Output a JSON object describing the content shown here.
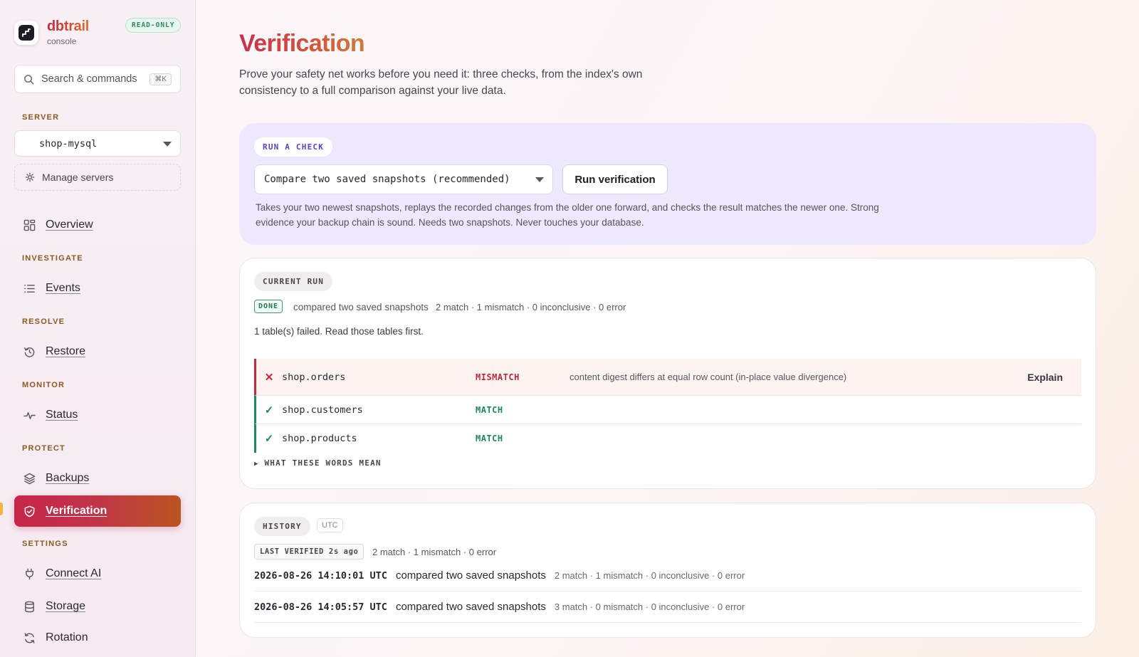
{
  "brand": {
    "name": "dbtrail",
    "subtitle": "console",
    "mode_badge": "READ-ONLY"
  },
  "search": {
    "placeholder": "Search & commands",
    "shortcut": "⌘K"
  },
  "server": {
    "section_label": "SERVER",
    "selected": "shop-mysql",
    "manage_label": "Manage servers"
  },
  "nav": {
    "overview": "Overview",
    "investigate_label": "INVESTIGATE",
    "events": "Events",
    "resolve_label": "RESOLVE",
    "restore": "Restore",
    "monitor_label": "MONITOR",
    "status": "Status",
    "protect_label": "PROTECT",
    "backups": "Backups",
    "verification": "Verification",
    "settings_label": "SETTINGS",
    "connect_ai": "Connect AI",
    "storage": "Storage",
    "rotation": "Rotation",
    "active": "verification"
  },
  "page": {
    "title": "Verification",
    "description": "Prove your safety net works before you need it: three checks, from the index's own consistency to a full comparison against your live data."
  },
  "run_check": {
    "label": "RUN A CHECK",
    "selected_check": "Compare two saved snapshots (recommended)",
    "button": "Run verification",
    "description": "Takes your two newest snapshots, replays the recorded changes from the older one forward, and checks the result matches the newer one. Strong evidence your backup chain is sound. Needs two snapshots. Never touches your database."
  },
  "current_run": {
    "label": "CURRENT RUN",
    "status": "DONE",
    "summary": "compared two saved snapshots",
    "counts": "2 match · 1 mismatch · 0 inconclusive · 0 error",
    "note": "1 table(s) failed. Read those tables first.",
    "tables": [
      {
        "name": "shop.orders",
        "status": "MISMATCH",
        "reason": "content digest differs at equal row count (in-place value divergence)",
        "action": "Explain"
      },
      {
        "name": "shop.customers",
        "status": "MATCH"
      },
      {
        "name": "shop.products",
        "status": "MATCH"
      }
    ],
    "glossary_toggle": "WHAT THESE WORDS MEAN"
  },
  "history": {
    "label": "HISTORY",
    "timezone": "UTC",
    "last_verified": "LAST VERIFIED 2s ago",
    "last_counts": "2 match · 1 mismatch · 0 error",
    "entries": [
      {
        "time": "2026-08-26 14:10:01 UTC",
        "desc": "compared two saved snapshots",
        "counts": "2 match · 1 mismatch · 0 inconclusive · 0 error"
      },
      {
        "time": "2026-08-26 14:05:57 UTC",
        "desc": "compared two saved snapshots",
        "counts": "3 match · 0 mismatch · 0 inconclusive · 0 error"
      }
    ]
  },
  "colors": {
    "accent": "#c7264a",
    "accent_end": "#b9541f",
    "match": "#1f8a58",
    "mismatch": "#c0283e",
    "run_panel": "#ede8fd"
  }
}
